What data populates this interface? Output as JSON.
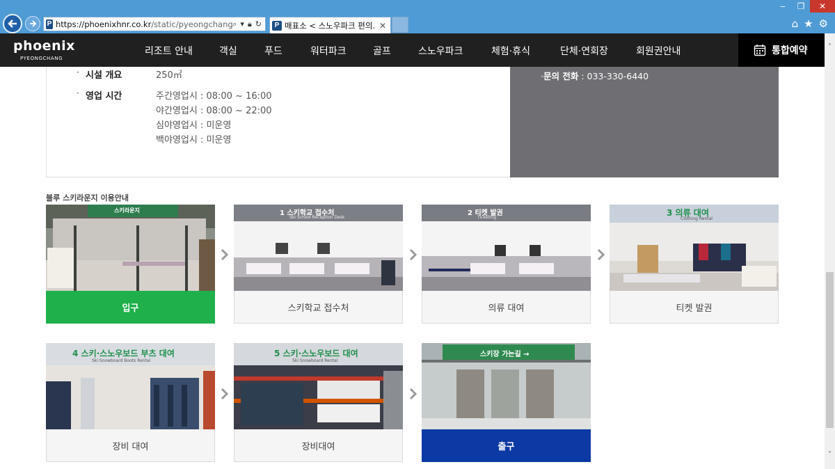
{
  "browser": {
    "url_host": "https://phoenixhnr.co.kr",
    "url_path": "/static/pyeongchang/snov",
    "tab_title": "매표소 < 스노우파크 편의...",
    "favicon_letter": "P"
  },
  "site": {
    "logo": "phoenix",
    "logo_sub": "PYEONGCHANG",
    "menu": [
      "리조트 안내",
      "객실",
      "푸드",
      "워터파크",
      "골프",
      "스노우파크",
      "체험·휴식",
      "단체·연회장",
      "회원권안내"
    ],
    "reserve_label": "통합예약"
  },
  "info": {
    "facility_label": "시설 개요",
    "facility_value": "250㎡",
    "hours_label": "영업 시간",
    "hours": [
      "주간영업시 : 08:00 ~ 16:00",
      "야간영업시 : 08:00 ~ 22:00",
      "심야영업시 : 미운영",
      "백야영업시 : 미운영"
    ],
    "contact_label": "문의 전화",
    "contact_value": " : 033-330-6440"
  },
  "guide": {
    "title": "블루 스키라운지 이용안내",
    "steps": [
      {
        "caption": "입구",
        "sign": "스키라운지",
        "sign_sub": ""
      },
      {
        "caption": "스키학교 접수처",
        "sign": "1  스키학교 접수처",
        "sign_sub": "Ski School Reception Desk"
      },
      {
        "caption": "의류 대여",
        "sign": "2  티켓 발권",
        "sign_sub": "Ticketing"
      },
      {
        "caption": "티켓 발권",
        "sign": "3  의류 대여",
        "sign_sub": "Clothing Rental"
      },
      {
        "caption": "장비 대여",
        "sign": "4  스키·스노우보드 부츠 대여",
        "sign_sub": "Ski·Snowboard Boots Rental"
      },
      {
        "caption": "장비대여",
        "sign": "5  스키·스노우보드 대여",
        "sign_sub": "Ski·Snowboard Rental"
      },
      {
        "caption": "출구",
        "sign": "스키장 가는길 →",
        "sign_sub": ""
      }
    ]
  },
  "colors": {
    "chrome": "#4f9bd5",
    "header": "#202020",
    "entrance": "#1fb04b",
    "exit": "#0b3aa5",
    "info_dark": "#6e6e73"
  }
}
